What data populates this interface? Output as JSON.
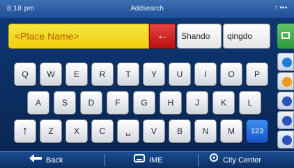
{
  "status_bar": {
    "time": "8:18 pm",
    "title": "Addsearch",
    "signal": "↑ ▪▪▪"
  },
  "search": {
    "placeholder": "<Place Name>",
    "clear_label": "←",
    "suggestions": [
      "Shando",
      "qingdo"
    ]
  },
  "side_panel": {
    "top_icon": "map-icon",
    "icons": [
      "globe-icon",
      "home-icon",
      "pin-icon",
      "poi-icon",
      "help-icon"
    ],
    "icon_colors": [
      "#1a7fd6",
      "#f09a1a",
      "#2a55b8",
      "#2a55b8",
      "#2a55b8"
    ]
  },
  "keyboard": {
    "row1": [
      "Q",
      "W",
      "E",
      "R",
      "T",
      "Y",
      "U",
      "I",
      "O",
      "P"
    ],
    "row2": [
      "A",
      "S",
      "D",
      "F",
      "G",
      "H",
      "J",
      "K",
      "L"
    ],
    "row3": [
      "↑",
      "Z",
      "X",
      "C",
      "␣",
      "V",
      "B",
      "N",
      "M",
      "123"
    ]
  },
  "bottom_bar": {
    "back_label": "Back",
    "ime_label": "IME",
    "city_label": "City Center"
  },
  "colors": {
    "field_yellow": "#f5d81c",
    "clear_red": "#d11f1f",
    "mode_blue": "#1f67d6",
    "panel_green": "#3aa846"
  }
}
